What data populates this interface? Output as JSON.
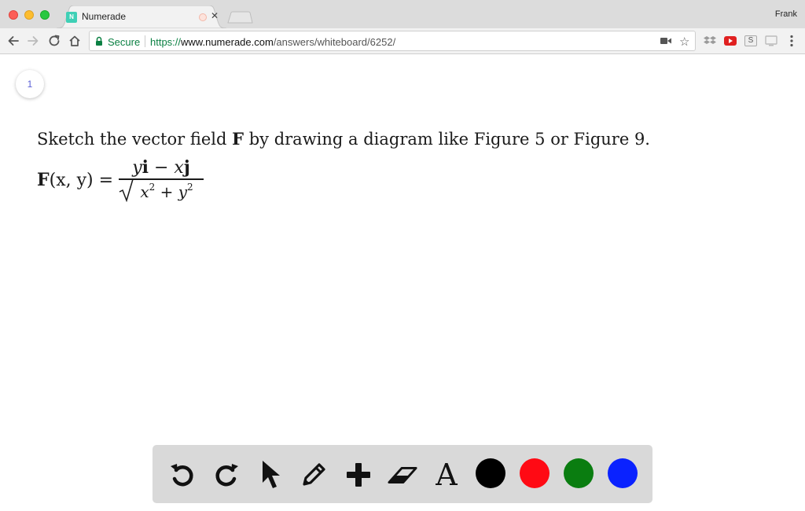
{
  "browser": {
    "tab_title": "Numerade",
    "tab_favicon_text": "N",
    "profile_name": "Frank",
    "secure_label": "Secure",
    "url_scheme": "https://",
    "url_host": "www.numerade.com",
    "url_path": "/answers/whiteboard/6252/",
    "extension_s_label": "S"
  },
  "page": {
    "page_number": "1",
    "question_prefix": "Sketch the vector field ",
    "question_bold": "F",
    "question_suffix": " by drawing a diagram like Figure 5 or Figure 9.",
    "equation": {
      "lhs_F": "F",
      "lhs_args": "(x, y) =",
      "numerator_y": "y",
      "numerator_i": "i",
      "numerator_op": " − ",
      "numerator_x": "x",
      "numerator_j": "j",
      "den_x": "x",
      "den_exp1": "2",
      "den_op": " + ",
      "den_y": "y",
      "den_exp2": "2"
    }
  },
  "palette": {
    "text_tool_glyph": "A",
    "colors": {
      "black": "#000000",
      "red": "#ff0a14",
      "green": "#0a7d10",
      "blue": "#0a22ff"
    }
  }
}
